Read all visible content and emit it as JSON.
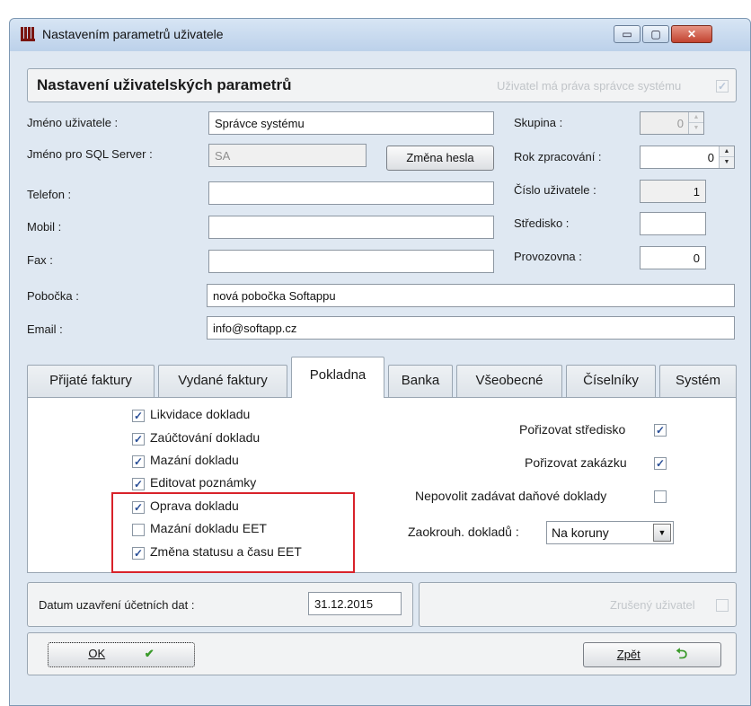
{
  "window": {
    "title": "Nastavením parametrů uživatele",
    "minimize_glyph": "▭",
    "maximize_glyph": "▢",
    "close_glyph": "✕"
  },
  "header": {
    "title": "Nastavení uživatelských parametrů",
    "admin_label": "Uživatel má práva správce systému",
    "admin_checked": true
  },
  "fields": {
    "user_name_label": "Jméno uživatele :",
    "user_name_value": "Správce systému",
    "sql_name_label": "Jméno pro SQL Server :",
    "sql_name_value": "SA",
    "change_password_label": "Změna hesla",
    "phone_label": "Telefon :",
    "phone_value": "",
    "mobile_label": "Mobil :",
    "mobile_value": "",
    "fax_label": "Fax :",
    "fax_value": "",
    "branch_label": "Pobočka :",
    "branch_value": "nová pobočka Softappu",
    "email_label": "Email :",
    "email_value": "info@softapp.cz"
  },
  "right_fields": {
    "group_label": "Skupina :",
    "group_value": "0",
    "year_label": "Rok zpracování :",
    "year_value": "0",
    "user_number_label": "Číslo uživatele :",
    "user_number_value": "1",
    "center_label": "Středisko :",
    "center_value": "",
    "shop_label": "Provozovna :",
    "shop_value": "0"
  },
  "tabs": [
    {
      "label": "Přijaté faktury",
      "active": false
    },
    {
      "label": "Vydané faktury",
      "active": false
    },
    {
      "label": "Pokladna",
      "active": true
    },
    {
      "label": "Banka",
      "active": false
    },
    {
      "label": "Všeobecné",
      "active": false
    },
    {
      "label": "Číselníky",
      "active": false
    },
    {
      "label": "Systém",
      "active": false
    }
  ],
  "cash_tab": {
    "left_checks": [
      {
        "label": "Likvidace dokladu",
        "checked": true
      },
      {
        "label": "Zaúčtování dokladu",
        "checked": true
      },
      {
        "label": "Mazání dokladu",
        "checked": true
      },
      {
        "label": "Editovat poznámky",
        "checked": true
      },
      {
        "label": "Oprava dokladu",
        "checked": true
      },
      {
        "label": "Mazání dokladu EET",
        "checked": false
      },
      {
        "label": "Změna statusu a času EET",
        "checked": true
      }
    ],
    "right_checks": [
      {
        "label": "Pořizovat středisko",
        "checked": true
      },
      {
        "label": "Pořizovat zakázku",
        "checked": true
      },
      {
        "label": "Nepovolit zadávat daňové doklady",
        "checked": false
      }
    ],
    "rounding_label": "Zaokrouh. dokladů :",
    "rounding_value": "Na koruny"
  },
  "bottom": {
    "close_date_label": "Datum uzavření účetních dat :",
    "close_date_value": "31.12.2015",
    "cancelled_label": "Zrušený uživatel",
    "cancelled_checked": false
  },
  "footer": {
    "ok_label": "OK",
    "back_label": "Zpět"
  },
  "colors": {
    "highlight": "#d8222a",
    "window_bg": "#dfe8f2",
    "check_mark": "#2a4f97"
  }
}
